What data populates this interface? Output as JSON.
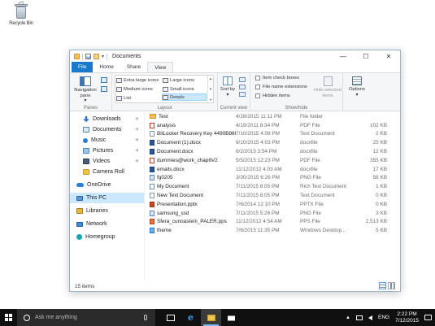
{
  "desktop": {
    "recycle_bin_label": "Recycle Bin"
  },
  "window": {
    "title": "Documents",
    "controls": {
      "minimize": "—",
      "maximize": "☐",
      "close": "✕"
    }
  },
  "tabs": [
    {
      "label": "File"
    },
    {
      "label": "Home"
    },
    {
      "label": "Share"
    },
    {
      "label": "View"
    }
  ],
  "ribbon": {
    "panes": {
      "label": "Panes",
      "navigation_pane": "Navigation pane",
      "navigation_pane_arrow": "▾"
    },
    "layout": {
      "label": "Layout",
      "options": [
        "Extra large icons",
        "Large icons",
        "Medium icons",
        "Small icons",
        "List",
        "Details"
      ],
      "selected": "Details"
    },
    "current_view": {
      "label": "Current view",
      "sort_by": "Sort by",
      "sort_by_arrow": "▾"
    },
    "show_hide": {
      "label": "Show/hide",
      "item_check_boxes": "Item check boxes",
      "file_name_extensions": "File name extensions",
      "hidden_items": "Hidden items",
      "hide_selected_items": "Hide selected items"
    },
    "options": {
      "label": "Options",
      "arrow": "▾"
    }
  },
  "nav": {
    "items": [
      {
        "label": "Downloads",
        "pinned": true
      },
      {
        "label": "Documents",
        "pinned": true
      },
      {
        "label": "Music",
        "pinned": true
      },
      {
        "label": "Pictures",
        "pinned": true
      },
      {
        "label": "Videos",
        "pinned": true
      },
      {
        "label": "Camera Roll",
        "pinned": false
      },
      {
        "label": "OneDrive",
        "pinned": false
      },
      {
        "label": "This PC",
        "pinned": false
      },
      {
        "label": "Libraries",
        "pinned": false
      },
      {
        "label": "Network",
        "pinned": false
      },
      {
        "label": "Homegroup",
        "pinned": false
      }
    ],
    "pin_glyph": "✈"
  },
  "files": [
    {
      "name": "Test",
      "date": "4/28/2015 11:11 PM",
      "type": "File folder",
      "size": ""
    },
    {
      "name": "analysis",
      "date": "4/19/2011 8:34 PM",
      "type": "PDF File",
      "size": "102 KB"
    },
    {
      "name": "BitLocker Recovery Key 4490B866-1D42-4...",
      "date": "7/10/2015 4:08 PM",
      "type": "Text Document",
      "size": "2 KB"
    },
    {
      "name": "Document (1).docx",
      "date": "6/10/2015 4:03 PM",
      "type": "docxfile",
      "size": "25 KB"
    },
    {
      "name": "Document.docx",
      "date": "6/2/2015 3:54 PM",
      "type": "docxfile",
      "size": "12 KB"
    },
    {
      "name": "dummies@work_chap6V2",
      "date": "5/5/2015 12:23 PM",
      "type": "PDF File",
      "size": "355 KB"
    },
    {
      "name": "emails.docx",
      "date": "11/12/2012 4:03 AM",
      "type": "docxfile",
      "size": "17 KB"
    },
    {
      "name": "fg0205",
      "date": "3/30/2015 6:26 PM",
      "type": "PNG File",
      "size": "56 KB"
    },
    {
      "name": "My Document",
      "date": "7/11/2015 8:05 PM",
      "type": "Rich Text Document",
      "size": "1 KB"
    },
    {
      "name": "New Text Document",
      "date": "7/11/2015 8:05 PM",
      "type": "Text Document",
      "size": "0 KB"
    },
    {
      "name": "Presentation.pptx",
      "date": "7/6/2014 12:10 PM",
      "type": "PPTX File",
      "size": "0 KB"
    },
    {
      "name": "samsung_ssd",
      "date": "7/11/2015 5:26 PM",
      "type": "PNG File",
      "size": "3 KB"
    },
    {
      "name": "Sfera_cunoasterii_PALER.pps",
      "date": "11/12/2012 4:54 AM",
      "type": "PPS File",
      "size": "2,513 KB"
    },
    {
      "name": "theme",
      "date": "7/6/2015 11:35 PM",
      "type": "Windows Desktop...",
      "size": "5 KB"
    }
  ],
  "file_icons": [
    "folder",
    "pdf",
    "txt",
    "docx",
    "docx",
    "pdf",
    "docx",
    "png",
    "rtf",
    "txt",
    "pptx",
    "png",
    "pps",
    "theme"
  ],
  "status": {
    "item_count": "15 items"
  },
  "taskbar": {
    "search_placeholder": "Ask me anything",
    "language": "ENG",
    "time": "2:22 PM",
    "date": "7/12/2015",
    "tray_up_arrow": "▲"
  }
}
